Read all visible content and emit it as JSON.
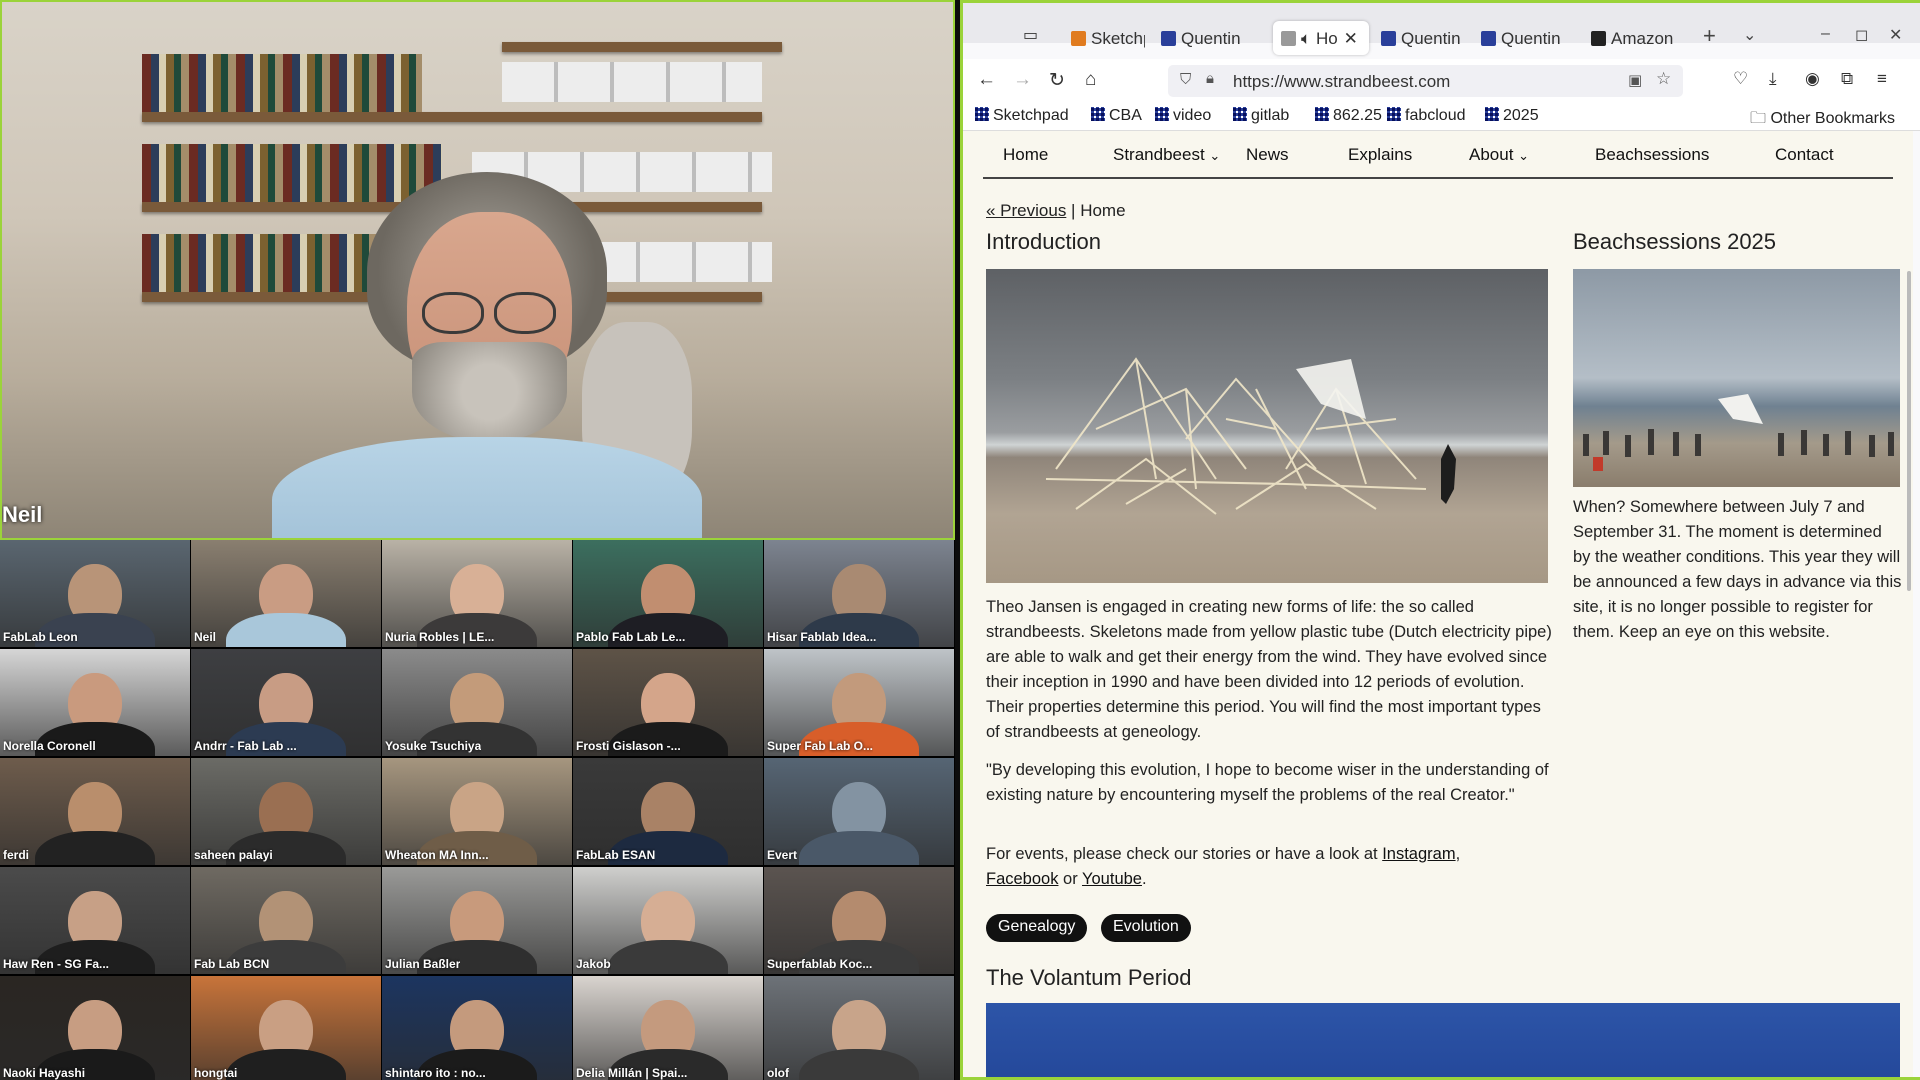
{
  "conference": {
    "speaker": "Neil",
    "participants": [
      {
        "name": "FabLab Leon",
        "bg": "#5a6670",
        "skin": "#b89478",
        "shirt": "#3a4250"
      },
      {
        "name": "Neil",
        "bg": "#8a7f70",
        "skin": "#c99c83",
        "shirt": "#a9c7da"
      },
      {
        "name": "Nuria Robles | LE...",
        "bg": "#b9b2a6",
        "skin": "#d8b096",
        "shirt": "#3c3a3a"
      },
      {
        "name": "Pablo Fab Lab Le...",
        "bg": "#3c6f5f",
        "skin": "#c18e70",
        "shirt": "#1e1e24"
      },
      {
        "name": "Hisar Fablab Idea...",
        "bg": "#7d8490",
        "skin": "#a98a72",
        "shirt": "#2e3a4a"
      },
      {
        "name": "Norella Coronell",
        "bg": "#d6d6d6",
        "skin": "#c99a7e",
        "shirt": "#1a1a1a"
      },
      {
        "name": "Andrr - Fab Lab ...",
        "bg": "#3e3f42",
        "skin": "#c89c84",
        "shirt": "#2c3b52"
      },
      {
        "name": "Yosuke Tsuchiya",
        "bg": "#8b8b8b",
        "skin": "#c39b7a",
        "shirt": "#333"
      },
      {
        "name": "Frosti Gislason -...",
        "bg": "#5e5347",
        "skin": "#d4a58a",
        "shirt": "#1b1b1b"
      },
      {
        "name": "Super Fab Lab O...",
        "bg": "#bfc4c8",
        "skin": "#c29a7c",
        "shirt": "#d85e2a"
      },
      {
        "name": "ferdi",
        "bg": "#6e5c4c",
        "skin": "#b98e6c",
        "shirt": "#222"
      },
      {
        "name": "saheen palayi",
        "bg": "#6b6b66",
        "skin": "#9a6f52",
        "shirt": "#2b2b2b"
      },
      {
        "name": "Wheaton MA Inn...",
        "bg": "#a6967f",
        "skin": "#c9a486",
        "shirt": "#6f5d48"
      },
      {
        "name": "FabLab ESAN",
        "bg": "#3a3a3a",
        "skin": "#a98266",
        "shirt": "#1d2a40"
      },
      {
        "name": "Evert",
        "bg": "#566574",
        "skin": "#8393a2",
        "shirt": "#4a5868"
      },
      {
        "name": "Haw Ren - SG Fa...",
        "bg": "#4b4b4b",
        "skin": "#c7a086",
        "shirt": "#1e1e1e"
      },
      {
        "name": "Fab Lab BCN",
        "bg": "#6f6a62",
        "skin": "#b29276",
        "shirt": "#3c3c3c"
      },
      {
        "name": "Julian Baßler",
        "bg": "#9a9a98",
        "skin": "#c89a7c",
        "shirt": "#2f2f2f"
      },
      {
        "name": "Jakob",
        "bg": "#cfcfcd",
        "skin": "#d6ae94",
        "shirt": "#3a3a3a"
      },
      {
        "name": "Superfablab Koc...",
        "bg": "#5b5450",
        "skin": "#b48b6e",
        "shirt": "#3b3b3b"
      },
      {
        "name": "Naoki Hayashi",
        "bg": "#2a2622",
        "skin": "#c79d82",
        "shirt": "#1a1a1a"
      },
      {
        "name": "hongtai",
        "bg": "#c8743a",
        "skin": "#c99f83",
        "shirt": "#1f1f1f"
      },
      {
        "name": "shintaro ito : no...",
        "bg": "#1c3560",
        "skin": "#c49a7d",
        "shirt": "#1b1b1b"
      },
      {
        "name": "Delia Millán | Spai...",
        "bg": "#d9d4cf",
        "skin": "#c49a7e",
        "shirt": "#2a2a2a"
      },
      {
        "name": "olof",
        "bg": "#6d7278",
        "skin": "#c8a48a",
        "shirt": "#3a3a3a"
      }
    ]
  },
  "browser": {
    "tabs": [
      {
        "label": "Sketchp",
        "fav": "#e07b1f"
      },
      {
        "label": "Quentin",
        "fav": "#2a3f9a"
      },
      {
        "label": "Ho",
        "fav": "#999999",
        "active": true
      },
      {
        "label": "Quentin",
        "fav": "#2a3f9a"
      },
      {
        "label": "Quentin",
        "fav": "#2a3f9a"
      },
      {
        "label": "Amazon",
        "fav": "#222222"
      }
    ],
    "url": "https://www.strandbeest.com",
    "bookmarks": [
      "Sketchpad",
      "CBA",
      "video",
      "gitlab",
      "862.25",
      "fabcloud",
      "2025"
    ],
    "other_bookmarks": "Other Bookmarks"
  },
  "site": {
    "menu": [
      "Home",
      "Strandbeest",
      "News",
      "Explains",
      "About",
      "Beachsessions",
      "Contact"
    ],
    "breadcrumb": {
      "previous": "« Previous",
      "sep": " | ",
      "current": "Home"
    },
    "intro": {
      "title": "Introduction",
      "p1": "Theo Jansen is engaged in creating new forms of life: the so called strandbeests. Skeletons made from yellow plastic tube (Dutch electricity pipe) are able to walk and get their energy from the wind. They have evolved since their inception in 1990 and have been divided into 12 periods of evolution. Their properties determine this period. You will find the most important types of strandbeests at geneology.",
      "p2": "\"By developing this evolution, I hope to become wiser in the understanding of existing nature by encountering myself the problems of the real Creator.\"",
      "p3_pre": "For events, please check our stories or have a look at ",
      "link_instagram": "Instagram",
      "p3_mid1": ",",
      "link_facebook": "Facebook",
      "p3_mid2": " or ",
      "link_youtube": "Youtube",
      "p3_end": "."
    },
    "beach": {
      "title": "Beachsessions 2025",
      "text": "When? Somewhere between July 7 and September 31. The moment is determined by the weather conditions. This year they will be announced a few days in advance via this site, it is no longer possible to register for them. Keep an eye on this website."
    },
    "pills": [
      "Genealogy",
      "Evolution"
    ],
    "volantum_title": "The Volantum Period"
  }
}
